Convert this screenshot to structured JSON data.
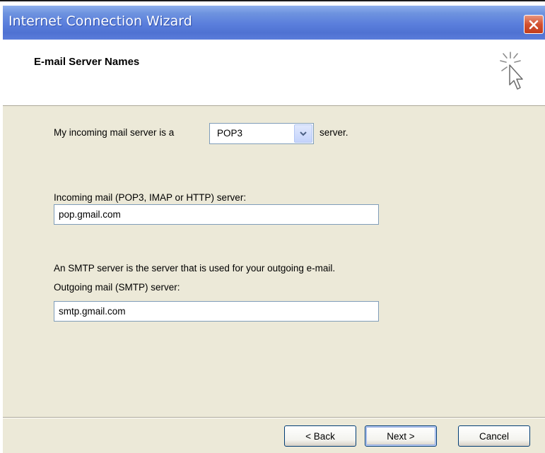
{
  "window": {
    "title": "Internet Connection Wizard",
    "close_icon": "close-icon"
  },
  "header": {
    "title": "E-mail Server Names",
    "icon": "wizard-cursor-icon"
  },
  "form": {
    "incoming_type_prefix": "My incoming mail server is a",
    "incoming_type_value": "POP3",
    "incoming_type_suffix": "server.",
    "incoming_label": "Incoming mail (POP3, IMAP or HTTP) server:",
    "incoming_value": "pop.gmail.com",
    "smtp_description": "An SMTP server is the server that is used for your outgoing e-mail.",
    "outgoing_label": "Outgoing mail (SMTP) server:",
    "outgoing_value": "smtp.gmail.com"
  },
  "buttons": {
    "back": "< Back",
    "next": "Next >",
    "cancel": "Cancel"
  }
}
